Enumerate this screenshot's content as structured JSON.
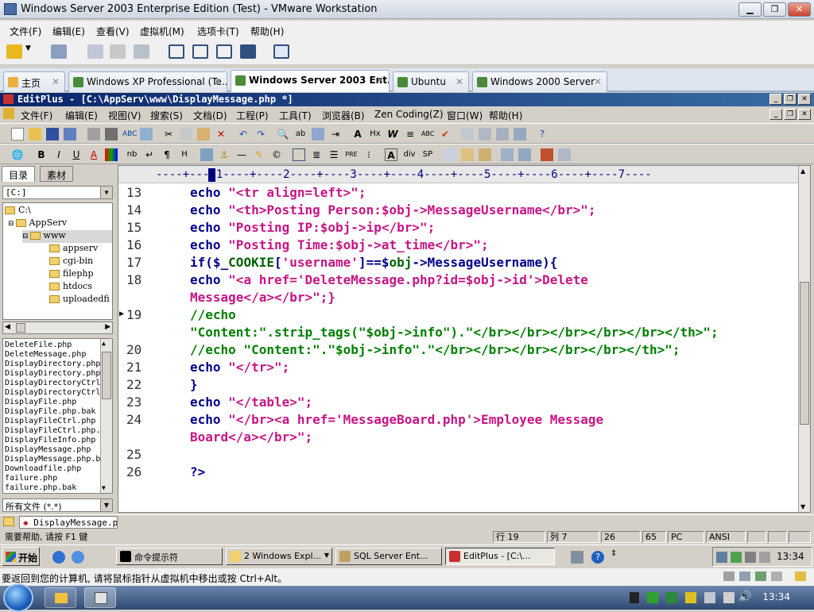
{
  "vm": {
    "title": "Windows Server 2003 Enterprise Edition (Test) - VMware Workstation",
    "menu": [
      "文件(F)",
      "编辑(E)",
      "查看(V)",
      "虚拟机(M)",
      "选项卡(T)",
      "帮助(H)"
    ],
    "tabs": [
      {
        "label": "主页",
        "icon_color": "#e8b040"
      },
      {
        "label": "Windows XP Professional (Te...",
        "icon_color": "#4a8a3a"
      },
      {
        "label": "Windows Server 2003 Ent...",
        "icon_color": "#4a8a3a"
      },
      {
        "label": "Ubuntu",
        "icon_color": "#4a8a3a"
      },
      {
        "label": "Windows 2000 Server",
        "icon_color": "#4a8a3a"
      }
    ],
    "tab_close": "✕"
  },
  "editplus": {
    "title": "EditPlus - [C:\\AppServ\\www\\DisplayMessage.php *]",
    "menu": [
      "文件(F)",
      "编辑(E)",
      "视图(V)",
      "搜索(S)",
      "文档(D)",
      "工程(P)",
      "工具(T)",
      "浏览器(B)",
      "Zen Coding(Z)",
      "窗口(W)",
      "帮助(H)"
    ],
    "left_tabs": [
      "目录",
      "素材"
    ],
    "drive": "[C:]",
    "tree": [
      "C:\\",
      "AppServ",
      "www",
      "appserv",
      "cgi-bin",
      "filephp",
      "htdocs",
      "uploadedfi"
    ],
    "files": [
      "DeleteFile.php",
      "DeleteMessage.php",
      "DisplayDirectory.php",
      "DisplayDirectory.php",
      "DisplayDirectoryCtrl",
      "DisplayDirectoryCtrl",
      "DisplayFile.php",
      "DisplayFile.php.bak",
      "DisplayFileCtrl.php",
      "DisplayFileCtrl.php.",
      "DisplayFileInfo.php",
      "DisplayMessage.php",
      "DisplayMessage.php.b",
      "Downloadfile.php",
      "failure.php",
      "failure.php.bak"
    ],
    "filter": "所有文件 (*.*)",
    "ruler": "----+----1----+----2----+----3----+----4----+----5----+----6----+----7----",
    "doc_tab": "DisplayMessage.php",
    "status": {
      "help": "需要帮助, 请按 F1 键",
      "row": "行 19",
      "col": "列 7",
      "c3": "26",
      "c4": "65",
      "c5": "PC",
      "c6": "ANSI"
    }
  },
  "code": [
    {
      "n": "13",
      "parts": [
        {
          "c": "kw",
          "t": "echo "
        },
        {
          "c": "st",
          "t": "\"<tr align=left>\";"
        }
      ]
    },
    {
      "n": "14",
      "parts": [
        {
          "c": "kw",
          "t": "echo "
        },
        {
          "c": "st",
          "t": "\"<th>Posting Person:$obj->MessageUsername</br>\";"
        }
      ]
    },
    {
      "n": "15",
      "parts": [
        {
          "c": "kw",
          "t": "echo "
        },
        {
          "c": "st",
          "t": "\"Posting IP:$obj->ip</br>\";"
        }
      ]
    },
    {
      "n": "16",
      "parts": [
        {
          "c": "kw",
          "t": "echo "
        },
        {
          "c": "st",
          "t": "\"Posting Time:$obj->at_time</br>\";"
        }
      ]
    },
    {
      "n": "17",
      "parts": [
        {
          "c": "kw",
          "t": "if($_"
        },
        {
          "c": "vr",
          "t": "COOKIE"
        },
        {
          "c": "kw",
          "t": "["
        },
        {
          "c": "st",
          "t": "'username'"
        },
        {
          "c": "kw",
          "t": "]==$"
        },
        {
          "c": "vr",
          "t": "obj"
        },
        {
          "c": "kw",
          "t": "->MessageUsername){"
        }
      ]
    },
    {
      "n": "18",
      "parts": [
        {
          "c": "kw",
          "t": "echo "
        },
        {
          "c": "st",
          "t": "\"<a href='DeleteMessage.php?id=$obj->id'>Delete"
        }
      ]
    },
    {
      "n": "",
      "parts": [
        {
          "c": "st",
          "t": "Message</a></br>\";}"
        }
      ]
    },
    {
      "n": "19",
      "parts": [
        {
          "c": "cm",
          "t": "//echo"
        }
      ]
    },
    {
      "n": "",
      "parts": [
        {
          "c": "cm",
          "t": "\"Content:\".strip_tags(\"$obj->info\").\"</br></br></br></br></br></th>\";"
        }
      ]
    },
    {
      "n": "20",
      "parts": [
        {
          "c": "cm",
          "t": "//echo \"Content:\".\"$obj->info\".\"</br></br></br></br></br></th>\";"
        }
      ]
    },
    {
      "n": "21",
      "parts": [
        {
          "c": "kw",
          "t": "echo "
        },
        {
          "c": "st",
          "t": "\"</tr>\";"
        }
      ]
    },
    {
      "n": "22",
      "parts": [
        {
          "c": "kw",
          "t": "}"
        }
      ]
    },
    {
      "n": "23",
      "parts": [
        {
          "c": "kw",
          "t": "echo "
        },
        {
          "c": "st",
          "t": "\"</table>\";"
        }
      ]
    },
    {
      "n": "24",
      "parts": [
        {
          "c": "kw",
          "t": "echo "
        },
        {
          "c": "st",
          "t": "\"</br><a href='MessageBoard.php'>Employee Message"
        }
      ]
    },
    {
      "n": "",
      "parts": [
        {
          "c": "st",
          "t": "Board</a></br>\";"
        }
      ]
    },
    {
      "n": "25",
      "parts": []
    },
    {
      "n": "26",
      "parts": [
        {
          "c": "kw",
          "t": "?>"
        }
      ]
    }
  ],
  "xp_taskbar": {
    "start": "开始",
    "buttons": [
      "命令提示符",
      "2 Windows Expl...",
      "SQL Server Ent...",
      "EditPlus - [C:\\..."
    ],
    "clock": "13:34"
  },
  "vm_hint": "要返回到您的计算机, 请将鼠标指针从虚拟机中移出或按 Ctrl+Alt。",
  "host_clock": "13:34"
}
